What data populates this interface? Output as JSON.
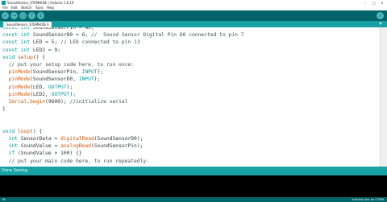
{
  "window": {
    "title": "SoundSensor_STEMHIDE | Arduino 1.8.19",
    "minimize": "–",
    "maximize": "□",
    "close": "✕"
  },
  "menu": [
    "File",
    "Edit",
    "Sketch",
    "Tools",
    "Help"
  ],
  "toolbar": {
    "verify_glyph": "✓",
    "upload_glyph": "→",
    "new_glyph": "▢",
    "open_glyph": "↑",
    "save_glyph": "↓",
    "serial_glyph": "⌕"
  },
  "tabs": [
    {
      "label": "SoundSensor_STEMHIDE §"
    }
  ],
  "tab_menu_glyph": "▾",
  "code_lines": [
    [
      {
        "t": "kw",
        "v": "const int"
      },
      {
        "t": "p",
        "v": " SoundSensorPin = A0;"
      }
    ],
    [
      {
        "t": "kw",
        "v": "const int"
      },
      {
        "t": "p",
        "v": " SoundSensorD0 = 6; "
      },
      {
        "t": "cm",
        "v": "//  Sound Sensor Digital Pin D0 connected to pin 7"
      }
    ],
    [
      {
        "t": "kw",
        "v": "const int"
      },
      {
        "t": "p",
        "v": " LED = 5; "
      },
      {
        "t": "cm",
        "v": "// LED connected to pin 13"
      }
    ],
    [
      {
        "t": "kw",
        "v": "const int"
      },
      {
        "t": "p",
        "v": " LED2 = 9;"
      }
    ],
    [
      {
        "t": "kw",
        "v": "void"
      },
      {
        "t": "p",
        "v": " "
      },
      {
        "t": "fn",
        "v": "setup"
      },
      {
        "t": "p",
        "v": "() {"
      }
    ],
    [
      {
        "t": "cm",
        "v": "  // put your setup code here, to run once:"
      }
    ],
    [
      {
        "t": "p",
        "v": "  "
      },
      {
        "t": "fn",
        "v": "pinMode"
      },
      {
        "t": "p",
        "v": "(SoundSensorPin, "
      },
      {
        "t": "kw",
        "v": "INPUT"
      },
      {
        "t": "p",
        "v": ");"
      }
    ],
    [
      {
        "t": "p",
        "v": "  "
      },
      {
        "t": "fn",
        "v": "pinMode"
      },
      {
        "t": "p",
        "v": "(SoundSensorD0, "
      },
      {
        "t": "kw",
        "v": "INPUT"
      },
      {
        "t": "p",
        "v": ");"
      }
    ],
    [
      {
        "t": "p",
        "v": "  "
      },
      {
        "t": "fn",
        "v": "pinMode"
      },
      {
        "t": "p",
        "v": "(LED, "
      },
      {
        "t": "kw",
        "v": "OUTPUT"
      },
      {
        "t": "p",
        "v": ");"
      }
    ],
    [
      {
        "t": "p",
        "v": "  "
      },
      {
        "t": "fn",
        "v": "pinMode"
      },
      {
        "t": "p",
        "v": "(LED2, "
      },
      {
        "t": "kw",
        "v": "OUTPUT"
      },
      {
        "t": "p",
        "v": ");"
      }
    ],
    [
      {
        "t": "p",
        "v": "  "
      },
      {
        "t": "fn",
        "v": "Serial"
      },
      {
        "t": "p",
        "v": "."
      },
      {
        "t": "fn",
        "v": "begin"
      },
      {
        "t": "p",
        "v": "(9600); "
      },
      {
        "t": "cm",
        "v": "//initialize serial"
      }
    ],
    [
      {
        "t": "p",
        "v": "}"
      }
    ],
    [
      {
        "t": "p",
        "v": ""
      }
    ],
    [
      {
        "t": "p",
        "v": ""
      }
    ],
    [
      {
        "t": "kw",
        "v": "void"
      },
      {
        "t": "p",
        "v": " "
      },
      {
        "t": "fn",
        "v": "loop"
      },
      {
        "t": "p",
        "v": "() {"
      }
    ],
    [
      {
        "t": "p",
        "v": "  "
      },
      {
        "t": "kw",
        "v": "int"
      },
      {
        "t": "p",
        "v": " SensorData = "
      },
      {
        "t": "fn",
        "v": "digitalRead"
      },
      {
        "t": "p",
        "v": "(SoundSensorD0);"
      }
    ],
    [
      {
        "t": "p",
        "v": "  "
      },
      {
        "t": "kw",
        "v": "int"
      },
      {
        "t": "p",
        "v": " SoundValue = "
      },
      {
        "t": "fn",
        "v": "analogRead"
      },
      {
        "t": "p",
        "v": "(SoundSensorPin);"
      }
    ],
    [
      {
        "t": "p",
        "v": "  "
      },
      {
        "t": "kw",
        "v": "if"
      },
      {
        "t": "p",
        "v": " (SoundValue > 100) {}"
      }
    ],
    [
      {
        "t": "cm",
        "v": "  // put your main code here, to run repeatedly:"
      }
    ]
  ],
  "status": {
    "message": "Done Saving."
  },
  "footer": {
    "line": "16",
    "board": "Arduino Uno on COM4"
  },
  "colors": {
    "toolbar": "#006468",
    "tab_strip": "#17a1a5",
    "keyword": "#00979c",
    "function": "#d35400",
    "comment": "#434f54",
    "console": "#000000"
  }
}
